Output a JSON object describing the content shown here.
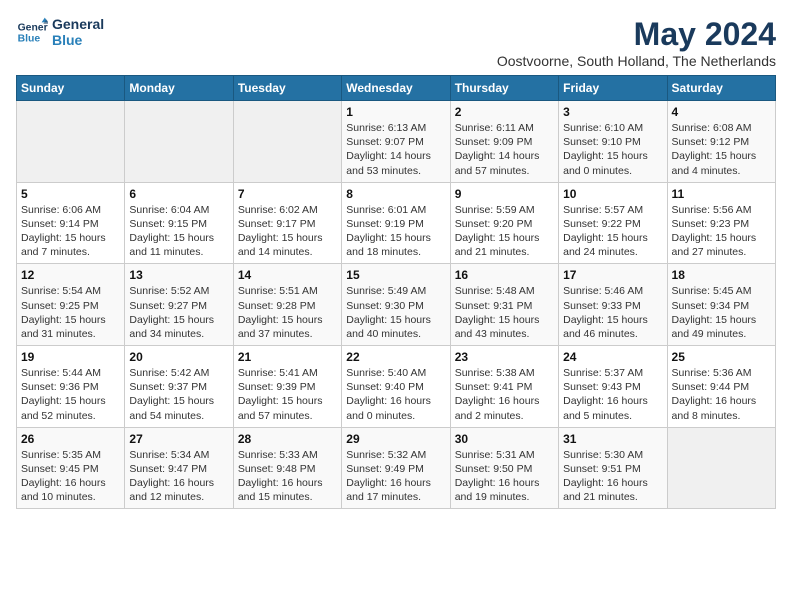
{
  "logo": {
    "line1": "General",
    "line2": "Blue"
  },
  "title": "May 2024",
  "subtitle": "Oostvoorne, South Holland, The Netherlands",
  "weekdays": [
    "Sunday",
    "Monday",
    "Tuesday",
    "Wednesday",
    "Thursday",
    "Friday",
    "Saturday"
  ],
  "weeks": [
    [
      {
        "day": "",
        "info": ""
      },
      {
        "day": "",
        "info": ""
      },
      {
        "day": "",
        "info": ""
      },
      {
        "day": "1",
        "info": "Sunrise: 6:13 AM\nSunset: 9:07 PM\nDaylight: 14 hours and 53 minutes."
      },
      {
        "day": "2",
        "info": "Sunrise: 6:11 AM\nSunset: 9:09 PM\nDaylight: 14 hours and 57 minutes."
      },
      {
        "day": "3",
        "info": "Sunrise: 6:10 AM\nSunset: 9:10 PM\nDaylight: 15 hours and 0 minutes."
      },
      {
        "day": "4",
        "info": "Sunrise: 6:08 AM\nSunset: 9:12 PM\nDaylight: 15 hours and 4 minutes."
      }
    ],
    [
      {
        "day": "5",
        "info": "Sunrise: 6:06 AM\nSunset: 9:14 PM\nDaylight: 15 hours and 7 minutes."
      },
      {
        "day": "6",
        "info": "Sunrise: 6:04 AM\nSunset: 9:15 PM\nDaylight: 15 hours and 11 minutes."
      },
      {
        "day": "7",
        "info": "Sunrise: 6:02 AM\nSunset: 9:17 PM\nDaylight: 15 hours and 14 minutes."
      },
      {
        "day": "8",
        "info": "Sunrise: 6:01 AM\nSunset: 9:19 PM\nDaylight: 15 hours and 18 minutes."
      },
      {
        "day": "9",
        "info": "Sunrise: 5:59 AM\nSunset: 9:20 PM\nDaylight: 15 hours and 21 minutes."
      },
      {
        "day": "10",
        "info": "Sunrise: 5:57 AM\nSunset: 9:22 PM\nDaylight: 15 hours and 24 minutes."
      },
      {
        "day": "11",
        "info": "Sunrise: 5:56 AM\nSunset: 9:23 PM\nDaylight: 15 hours and 27 minutes."
      }
    ],
    [
      {
        "day": "12",
        "info": "Sunrise: 5:54 AM\nSunset: 9:25 PM\nDaylight: 15 hours and 31 minutes."
      },
      {
        "day": "13",
        "info": "Sunrise: 5:52 AM\nSunset: 9:27 PM\nDaylight: 15 hours and 34 minutes."
      },
      {
        "day": "14",
        "info": "Sunrise: 5:51 AM\nSunset: 9:28 PM\nDaylight: 15 hours and 37 minutes."
      },
      {
        "day": "15",
        "info": "Sunrise: 5:49 AM\nSunset: 9:30 PM\nDaylight: 15 hours and 40 minutes."
      },
      {
        "day": "16",
        "info": "Sunrise: 5:48 AM\nSunset: 9:31 PM\nDaylight: 15 hours and 43 minutes."
      },
      {
        "day": "17",
        "info": "Sunrise: 5:46 AM\nSunset: 9:33 PM\nDaylight: 15 hours and 46 minutes."
      },
      {
        "day": "18",
        "info": "Sunrise: 5:45 AM\nSunset: 9:34 PM\nDaylight: 15 hours and 49 minutes."
      }
    ],
    [
      {
        "day": "19",
        "info": "Sunrise: 5:44 AM\nSunset: 9:36 PM\nDaylight: 15 hours and 52 minutes."
      },
      {
        "day": "20",
        "info": "Sunrise: 5:42 AM\nSunset: 9:37 PM\nDaylight: 15 hours and 54 minutes."
      },
      {
        "day": "21",
        "info": "Sunrise: 5:41 AM\nSunset: 9:39 PM\nDaylight: 15 hours and 57 minutes."
      },
      {
        "day": "22",
        "info": "Sunrise: 5:40 AM\nSunset: 9:40 PM\nDaylight: 16 hours and 0 minutes."
      },
      {
        "day": "23",
        "info": "Sunrise: 5:38 AM\nSunset: 9:41 PM\nDaylight: 16 hours and 2 minutes."
      },
      {
        "day": "24",
        "info": "Sunrise: 5:37 AM\nSunset: 9:43 PM\nDaylight: 16 hours and 5 minutes."
      },
      {
        "day": "25",
        "info": "Sunrise: 5:36 AM\nSunset: 9:44 PM\nDaylight: 16 hours and 8 minutes."
      }
    ],
    [
      {
        "day": "26",
        "info": "Sunrise: 5:35 AM\nSunset: 9:45 PM\nDaylight: 16 hours and 10 minutes."
      },
      {
        "day": "27",
        "info": "Sunrise: 5:34 AM\nSunset: 9:47 PM\nDaylight: 16 hours and 12 minutes."
      },
      {
        "day": "28",
        "info": "Sunrise: 5:33 AM\nSunset: 9:48 PM\nDaylight: 16 hours and 15 minutes."
      },
      {
        "day": "29",
        "info": "Sunrise: 5:32 AM\nSunset: 9:49 PM\nDaylight: 16 hours and 17 minutes."
      },
      {
        "day": "30",
        "info": "Sunrise: 5:31 AM\nSunset: 9:50 PM\nDaylight: 16 hours and 19 minutes."
      },
      {
        "day": "31",
        "info": "Sunrise: 5:30 AM\nSunset: 9:51 PM\nDaylight: 16 hours and 21 minutes."
      },
      {
        "day": "",
        "info": ""
      }
    ]
  ]
}
